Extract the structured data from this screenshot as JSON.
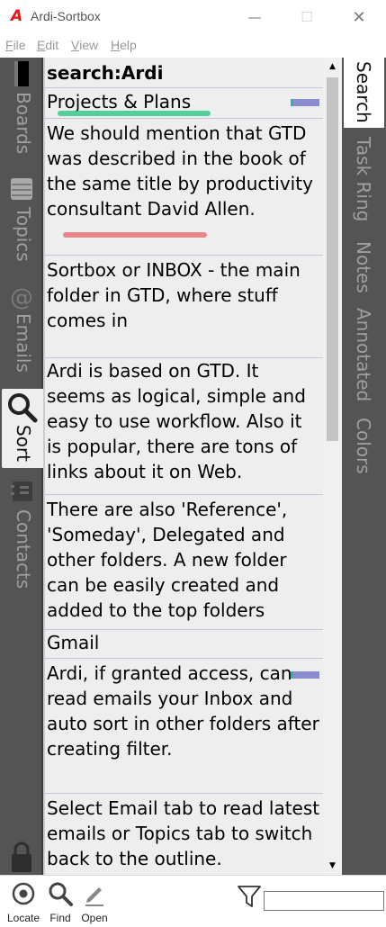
{
  "window": {
    "logo": "A",
    "title": "Ardi-Sortbox",
    "minimize": "—",
    "maximize": "☐",
    "close": "✕"
  },
  "menu": [
    {
      "label": "File",
      "underline": "F",
      "rest": "ile"
    },
    {
      "label": "Edit",
      "underline": "E",
      "rest": "dit"
    },
    {
      "label": "View",
      "underline": "V",
      "rest": "iew"
    },
    {
      "label": "Help",
      "underline": "H",
      "rest": "elp"
    }
  ],
  "left_tabs": {
    "boards": "Boards",
    "topics": "Topics",
    "emails": "Emails",
    "sort": "Sort",
    "contacts": "Contacts"
  },
  "content": {
    "header": "search:Ardi",
    "items": [
      {
        "text": "Projects & Plans"
      },
      {
        "text": "We should mention that GTD was described in the book of the same title by productivity consultant David Allen."
      },
      {
        "text": "Sortbox or INBOX - the main folder in GTD, where stuff comes in"
      },
      {
        "text": "Ardi is based on GTD. It seems as logical, simple and easy to use workflow. Also it is popular, there are tons of links about it on Web."
      },
      {
        "text": "There are also 'Reference', 'Someday', Delegated and other folders. A new folder can be easily created and added to the top folders"
      },
      {
        "text": "Gmail"
      },
      {
        "text": "Ardi, if granted access, can read emails your Inbox and auto sort in other folders after creating filter."
      },
      {
        "text": "Select Email tab to read latest emails or Topics tab to switch back to the outline."
      }
    ]
  },
  "right_tabs": {
    "search": "Search",
    "task_ring": "Task Ring",
    "notes": "Notes",
    "annotated": "Annotated",
    "colors": "Colors"
  },
  "toolbar": {
    "locate": "Locate",
    "find": "Find",
    "open": "Open",
    "filter_value": ""
  },
  "colors": {
    "accent_red": "#e8141c",
    "tag_purple": "#8b8bd0",
    "tag_teal": "#2bb5a9",
    "highlight_green": "#38c989",
    "highlight_red": "#e8727c",
    "sidebar": "#545454"
  }
}
